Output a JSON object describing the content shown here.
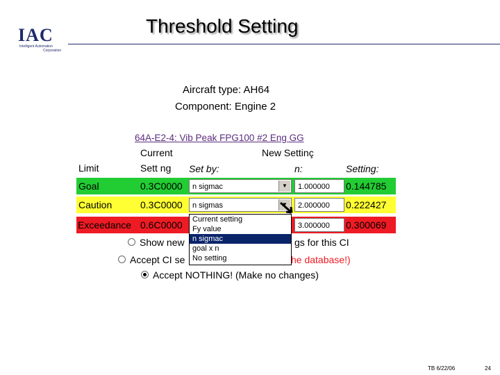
{
  "slide": {
    "title": "Threshold Setting",
    "logo": {
      "main": "IAC",
      "sub1": "Intelligent Automation",
      "sub2": "Corporation"
    },
    "aircraft": "Aircraft type: AH64",
    "component": "Component: Engine 2",
    "ci_title": "64A-E2-4: Vib Peak FPG100 #2 Eng GG",
    "footer_left": "TB 6/22/06",
    "footer_page": "24"
  },
  "table": {
    "headers": {
      "limit": "Limit",
      "current": "Current",
      "current2": "Sett ng",
      "set_by": "Set by:",
      "new_setting": "New Settinç",
      "new_setting2": "n:",
      "setting": "Setting:"
    },
    "rows": [
      {
        "limit": "Goal",
        "current": "0.3C0000",
        "set_by": "n sigmac",
        "new": "1.000000",
        "setting": "0.144785",
        "color": "#22cc33"
      },
      {
        "limit": "Caution",
        "current": "0.3C0000",
        "set_by": "n sigmas",
        "new": "2.000000",
        "setting": "0.222427",
        "color": "#ffff33"
      },
      {
        "limit": "Exceedance",
        "current": "0.6C0000",
        "set_by": "",
        "new": "3.000000",
        "setting": "0.300069",
        "color": "#ee1b24"
      }
    ],
    "dropdown_options": [
      "Current setting",
      "Fy value",
      "n sigmac",
      "goal x n",
      "No setting"
    ],
    "dropdown_selected_index": 2
  },
  "options": {
    "opt1_left": "Show new",
    "opt1_right": "gs for this CI",
    "opt2_left": "Accept CI se",
    "opt2_right": "he database!)",
    "opt3": "Accept NOTHING! (Make no changes)",
    "selected": 3
  }
}
